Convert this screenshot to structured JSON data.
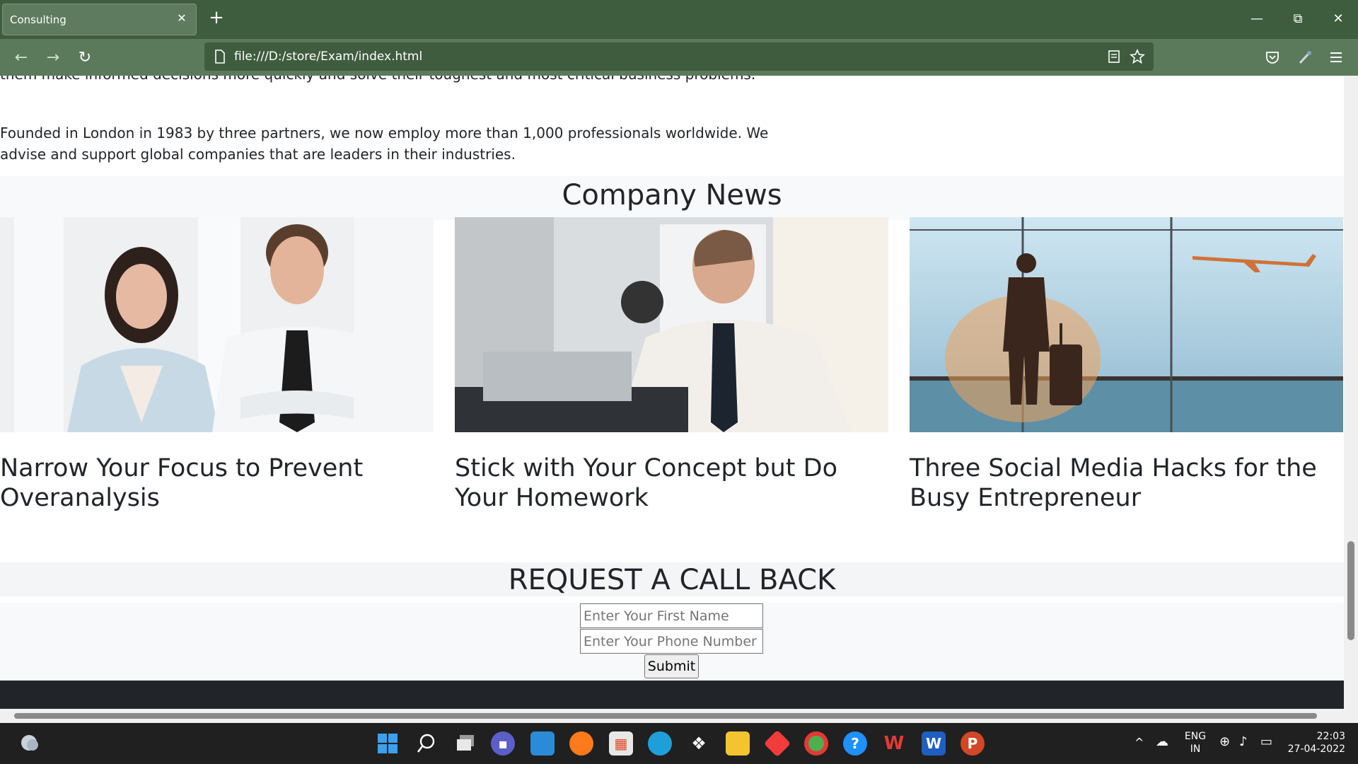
{
  "browser": {
    "tab_title": "Consulting",
    "tab_close": "✕",
    "new_tab": "+",
    "url": "file:///D:/store/Exam/index.html",
    "window_controls": {
      "minimize": "—",
      "restore": "⧉",
      "close": "✕"
    },
    "nav": {
      "back": "←",
      "forward": "→",
      "reload": "↻"
    },
    "icons": [
      "reader-mode-icon",
      "bookmark-star-icon",
      "pocket-icon",
      "extension-icon",
      "menu-icon"
    ]
  },
  "page": {
    "cut_text": "them make informed decisions more quickly and solve their toughest and most critical business problems.",
    "intro": "Founded in London in 1983 by three partners, we now employ more than 1,000 professionals worldwide. We advise and support global companies that are leaders in their industries.",
    "news_title": "Company News",
    "news": [
      {
        "title": "Narrow Your Focus to Prevent Overanalysis"
      },
      {
        "title": "Stick with Your Concept but Do Your Homework"
      },
      {
        "title": "Three Social Media Hacks for the Busy Entrepreneur"
      }
    ],
    "callback_title": "REQUEST A CALL BACK",
    "form": {
      "first_name_placeholder": "Enter Your First Name",
      "phone_placeholder": "Enter Your Phone Number",
      "submit_label": "Submit"
    }
  },
  "taskbar": {
    "lang_top": "ENG",
    "lang_bottom": "IN",
    "time": "22:03",
    "date": "27-04-2022"
  },
  "colors": {
    "chrome": "#3e5c3e",
    "navbar": "#5b7a5b",
    "footer": "#212529"
  }
}
